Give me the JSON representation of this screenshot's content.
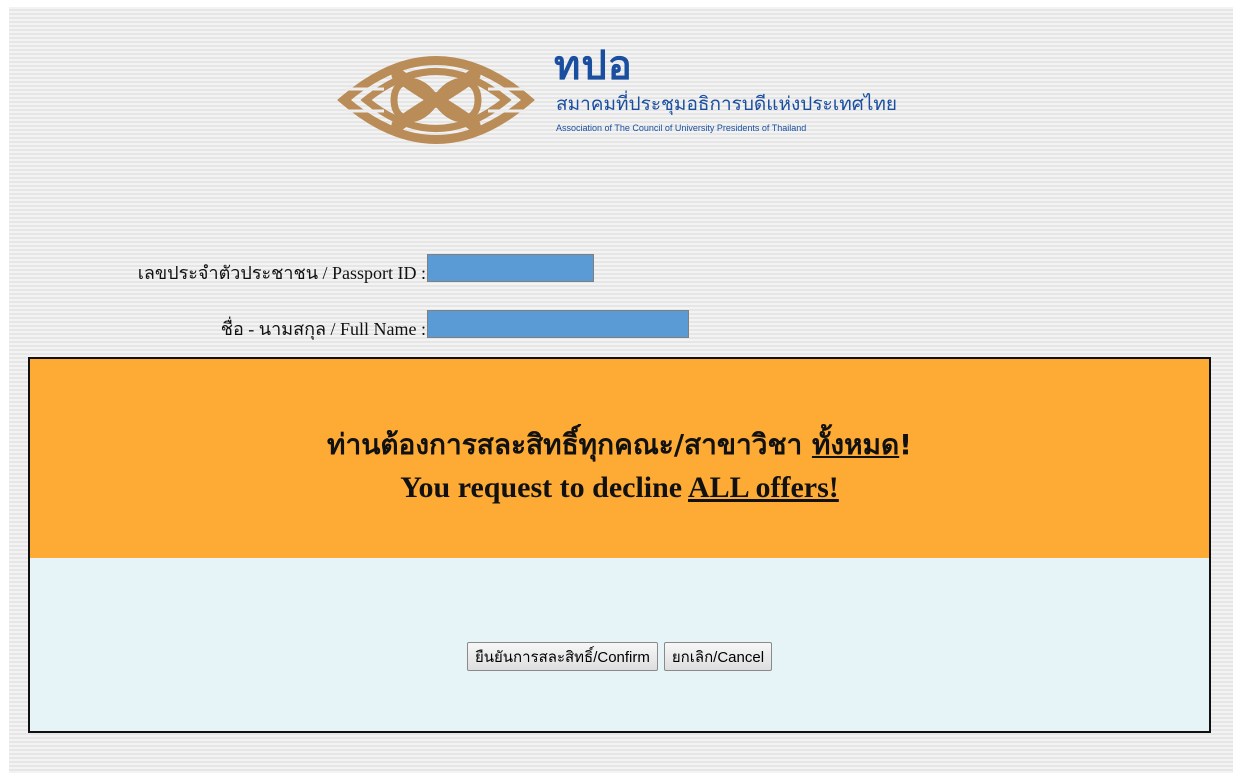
{
  "logo": {
    "title": "ทปอ",
    "thai_name": "สมาคมที่ประชุมอธิการบดีแห่งประเทศไทย",
    "english_name": "Association of The Council of University Presidents of Thailand",
    "brand_colors": {
      "mark": "#b98c58",
      "text": "#1a4fa0"
    }
  },
  "fields": {
    "passport_label": "เลขประจำตัวประชาชน / Passport ID :",
    "passport_value": "",
    "fullname_label": "ชื่อ - นามสกุล / Full Name :",
    "fullname_value": "",
    "redaction_color": "#5b9bd5"
  },
  "dialog": {
    "warning_th_prefix": "ท่านต้องการสละสิทธิ์ทุกคณะ/สาขาวิชา ",
    "warning_th_emphasis": "ทั้งหมด",
    "warning_th_suffix": "!",
    "warning_en_prefix": "You request to decline ",
    "warning_en_emphasis": "ALL offers!",
    "warning_bg": "#fdab35",
    "actions_bg": "#e6f4f8",
    "confirm_label": "ยืนยันการสละสิทธิ์/Confirm",
    "cancel_label": "ยกเลิก/Cancel"
  }
}
